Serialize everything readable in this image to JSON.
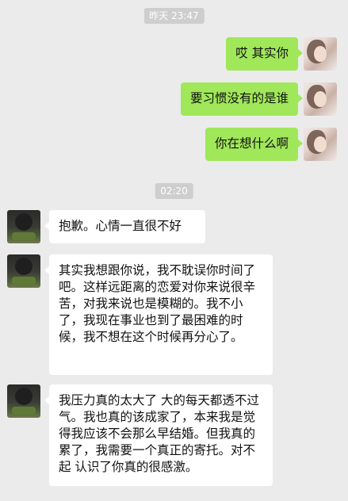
{
  "timestamps": [
    "昨天 23:47",
    "02:20"
  ],
  "messages": [
    {
      "side": "self",
      "text": "哎 其实你"
    },
    {
      "side": "self",
      "text": "要习惯没有的是谁"
    },
    {
      "side": "self",
      "text": "你在想什么啊"
    },
    {
      "side": "other",
      "text": "抱歉。心情一直很不好"
    },
    {
      "side": "other",
      "text": "其实我想跟你说，我不耽误你时间了吧。这样远距离的恋爱对你来说很辛苦，对我来说也是模糊的。我不小了，我现在事业也到了最困难的时候，我不想在这个时候再分心了。"
    },
    {
      "side": "other",
      "text": "我压力真的太大了 大的每天都透不过气。我也真的该成家了，本来我是觉得我应该不会那么早结婚。但我真的累了，我需要一个真正的寄托。对不起 认识了你真的很感激。"
    }
  ],
  "colors": {
    "background": "#ebebeb",
    "outgoing_bubble": "#a0e75a",
    "incoming_bubble": "#ffffff",
    "timestamp_bg": "#cecece"
  }
}
